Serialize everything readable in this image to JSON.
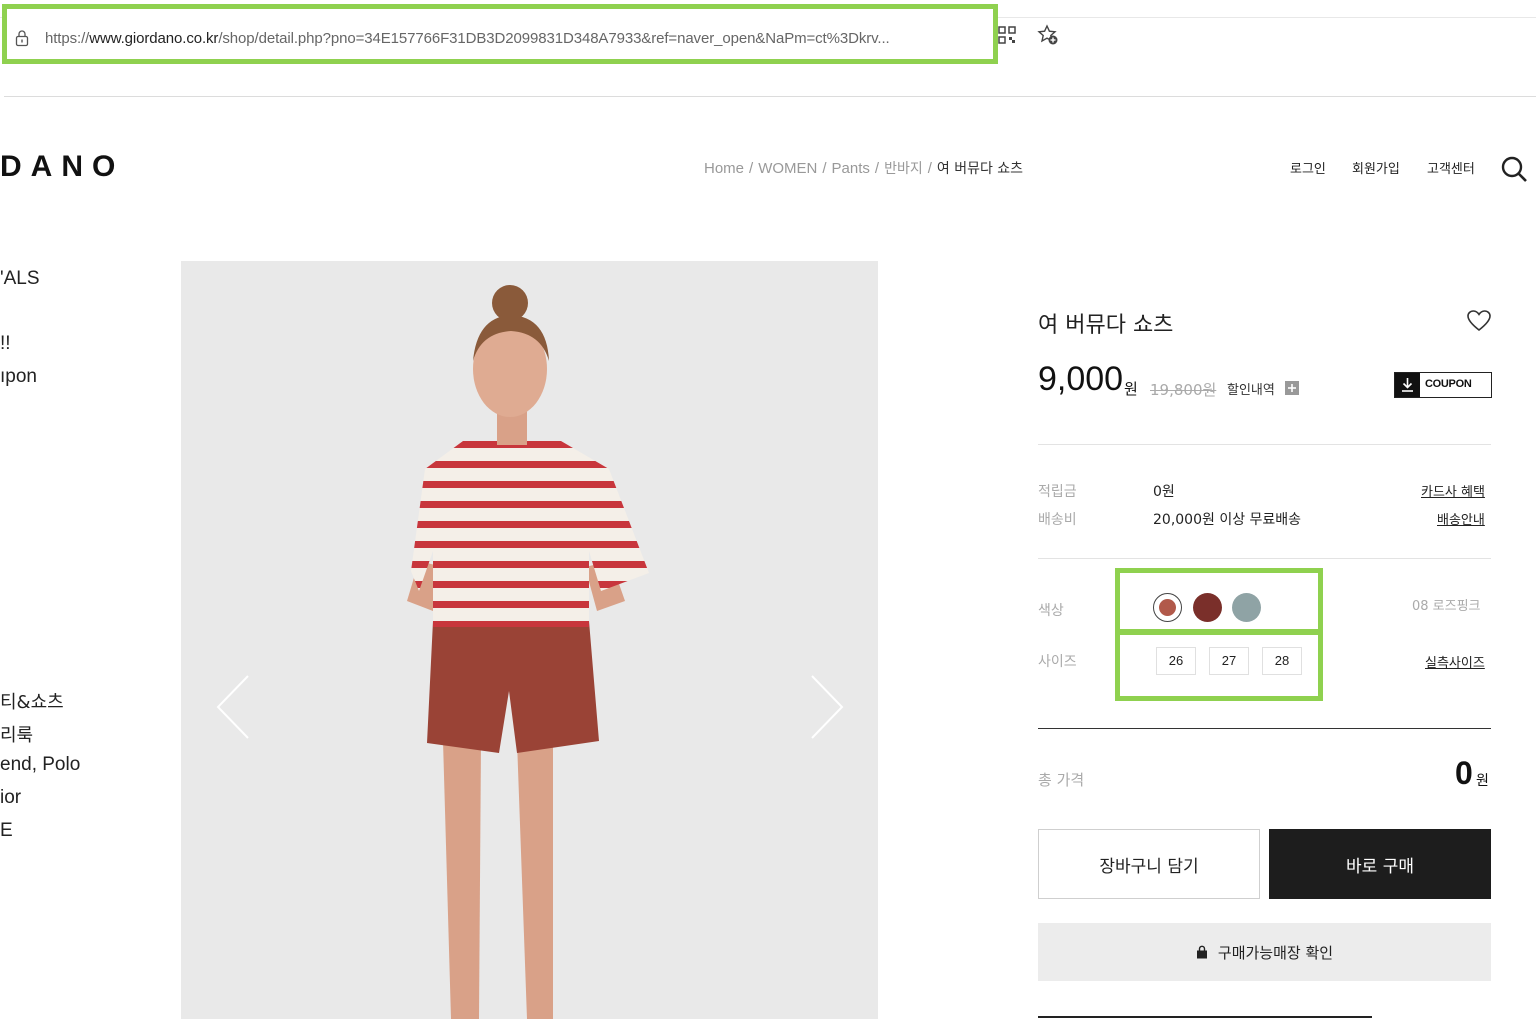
{
  "browser": {
    "url_prefix": "https://",
    "url_domain": "www.giordano.co.kr",
    "url_rest": "/shop/detail.php?pno=34E157766F31DB3D2099831D348A7933&ref=naver_open&NaPm=ct%3Dkrv...",
    "icons": [
      "lock-icon",
      "qr-grid-icon",
      "favorite-add-icon"
    ],
    "highlight_color": "#8fd14f"
  },
  "header": {
    "logo": "DANO",
    "breadcrumb": [
      "Home",
      "WOMEN",
      "Pants",
      "반바지",
      "여 버뮤다 쇼츠"
    ],
    "breadcrumb_sep": "/",
    "nav": [
      "로그인",
      "회원가입",
      "고객센터"
    ]
  },
  "sidebar": {
    "items": [
      "'ALS",
      "!!",
      "ıpon",
      "티&쇼츠",
      "리룩",
      "end, Polo",
      "ior",
      "E"
    ]
  },
  "product": {
    "title": "여 버뮤다 쇼츠",
    "price": "9,000",
    "price_unit": "원",
    "original_price": "19,800원",
    "discount_label": "할인내역",
    "coupon_label": "COUPON",
    "rows": [
      {
        "label": "적립금",
        "value": "0원",
        "link": "카드사 혜택"
      },
      {
        "label": "배송비",
        "value": "20,000원 이상 무료배송",
        "link": "배송안내"
      }
    ],
    "color_label": "색상",
    "colors": [
      "#b1594a",
      "#7a2f2a",
      "#8fa3a5"
    ],
    "selected_color": "08 로즈핑크",
    "size_label": "사이즈",
    "sizes": [
      "26",
      "27",
      "28"
    ],
    "size_link": "실측사이즈",
    "total_label": "총 가격",
    "total_value": "0",
    "total_unit": "원",
    "cart_button": "장바구니 담기",
    "buy_button": "바로 구매",
    "store_button": "구매가능매장 확인"
  }
}
